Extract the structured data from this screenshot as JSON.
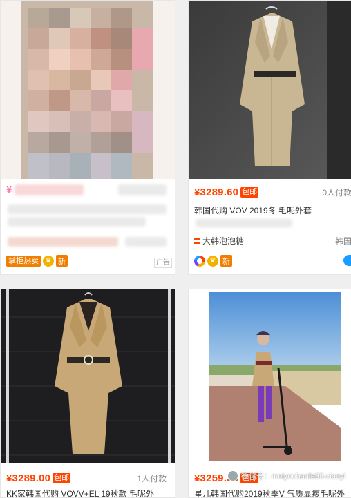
{
  "colors": {
    "price": "#ff4400",
    "baoyou": "#ff4400",
    "badge_orange": "#f07e00"
  },
  "cards": [
    {
      "id": "card1",
      "price": "¥",
      "badge_hot": "掌柜热卖",
      "badge_new": "新",
      "ad_label": "广告"
    },
    {
      "id": "card2",
      "price": "¥3289.60",
      "baoyou": "包邮",
      "paycount": "0人付款",
      "title": "韩国代购 VOV 2019冬 毛呢外套",
      "shop": "大韩泡泡糖",
      "location": "韩国",
      "badge_new": "新"
    },
    {
      "id": "card3",
      "price": "¥3289.00",
      "baoyou": "包邮",
      "paycount": "1人付款",
      "title": "KK家韩国代购 VOVV+EL 19秋款 毛呢外"
    },
    {
      "id": "card4",
      "price": "¥3259.35",
      "baoyou": "包邮",
      "title": "星儿韩国代购2019秋季V 气质显瘦毛呢外"
    }
  ],
  "watermark": {
    "text": "微信号：meiyoubanfa88-xiaoyi"
  }
}
